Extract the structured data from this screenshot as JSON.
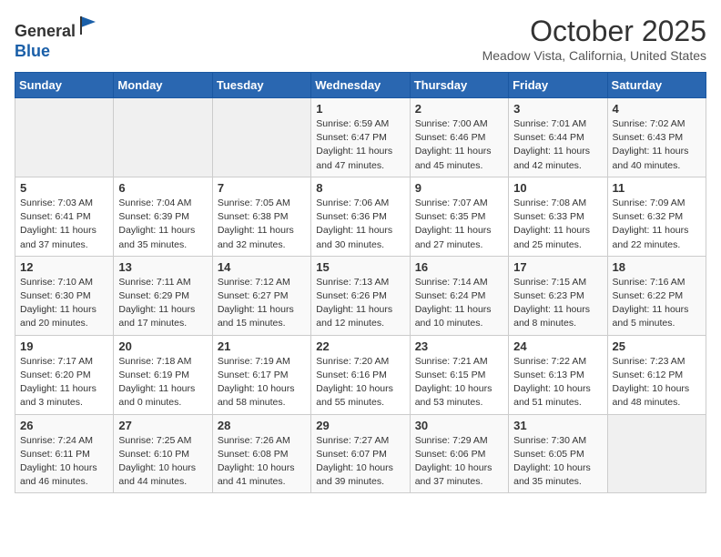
{
  "header": {
    "logo_line1": "General",
    "logo_line2": "Blue",
    "month": "October 2025",
    "location": "Meadow Vista, California, United States"
  },
  "weekdays": [
    "Sunday",
    "Monday",
    "Tuesday",
    "Wednesday",
    "Thursday",
    "Friday",
    "Saturday"
  ],
  "weeks": [
    [
      {
        "day": "",
        "info": ""
      },
      {
        "day": "",
        "info": ""
      },
      {
        "day": "",
        "info": ""
      },
      {
        "day": "1",
        "info": "Sunrise: 6:59 AM\nSunset: 6:47 PM\nDaylight: 11 hours\nand 47 minutes."
      },
      {
        "day": "2",
        "info": "Sunrise: 7:00 AM\nSunset: 6:46 PM\nDaylight: 11 hours\nand 45 minutes."
      },
      {
        "day": "3",
        "info": "Sunrise: 7:01 AM\nSunset: 6:44 PM\nDaylight: 11 hours\nand 42 minutes."
      },
      {
        "day": "4",
        "info": "Sunrise: 7:02 AM\nSunset: 6:43 PM\nDaylight: 11 hours\nand 40 minutes."
      }
    ],
    [
      {
        "day": "5",
        "info": "Sunrise: 7:03 AM\nSunset: 6:41 PM\nDaylight: 11 hours\nand 37 minutes."
      },
      {
        "day": "6",
        "info": "Sunrise: 7:04 AM\nSunset: 6:39 PM\nDaylight: 11 hours\nand 35 minutes."
      },
      {
        "day": "7",
        "info": "Sunrise: 7:05 AM\nSunset: 6:38 PM\nDaylight: 11 hours\nand 32 minutes."
      },
      {
        "day": "8",
        "info": "Sunrise: 7:06 AM\nSunset: 6:36 PM\nDaylight: 11 hours\nand 30 minutes."
      },
      {
        "day": "9",
        "info": "Sunrise: 7:07 AM\nSunset: 6:35 PM\nDaylight: 11 hours\nand 27 minutes."
      },
      {
        "day": "10",
        "info": "Sunrise: 7:08 AM\nSunset: 6:33 PM\nDaylight: 11 hours\nand 25 minutes."
      },
      {
        "day": "11",
        "info": "Sunrise: 7:09 AM\nSunset: 6:32 PM\nDaylight: 11 hours\nand 22 minutes."
      }
    ],
    [
      {
        "day": "12",
        "info": "Sunrise: 7:10 AM\nSunset: 6:30 PM\nDaylight: 11 hours\nand 20 minutes."
      },
      {
        "day": "13",
        "info": "Sunrise: 7:11 AM\nSunset: 6:29 PM\nDaylight: 11 hours\nand 17 minutes."
      },
      {
        "day": "14",
        "info": "Sunrise: 7:12 AM\nSunset: 6:27 PM\nDaylight: 11 hours\nand 15 minutes."
      },
      {
        "day": "15",
        "info": "Sunrise: 7:13 AM\nSunset: 6:26 PM\nDaylight: 11 hours\nand 12 minutes."
      },
      {
        "day": "16",
        "info": "Sunrise: 7:14 AM\nSunset: 6:24 PM\nDaylight: 11 hours\nand 10 minutes."
      },
      {
        "day": "17",
        "info": "Sunrise: 7:15 AM\nSunset: 6:23 PM\nDaylight: 11 hours\nand 8 minutes."
      },
      {
        "day": "18",
        "info": "Sunrise: 7:16 AM\nSunset: 6:22 PM\nDaylight: 11 hours\nand 5 minutes."
      }
    ],
    [
      {
        "day": "19",
        "info": "Sunrise: 7:17 AM\nSunset: 6:20 PM\nDaylight: 11 hours\nand 3 minutes."
      },
      {
        "day": "20",
        "info": "Sunrise: 7:18 AM\nSunset: 6:19 PM\nDaylight: 11 hours\nand 0 minutes."
      },
      {
        "day": "21",
        "info": "Sunrise: 7:19 AM\nSunset: 6:17 PM\nDaylight: 10 hours\nand 58 minutes."
      },
      {
        "day": "22",
        "info": "Sunrise: 7:20 AM\nSunset: 6:16 PM\nDaylight: 10 hours\nand 55 minutes."
      },
      {
        "day": "23",
        "info": "Sunrise: 7:21 AM\nSunset: 6:15 PM\nDaylight: 10 hours\nand 53 minutes."
      },
      {
        "day": "24",
        "info": "Sunrise: 7:22 AM\nSunset: 6:13 PM\nDaylight: 10 hours\nand 51 minutes."
      },
      {
        "day": "25",
        "info": "Sunrise: 7:23 AM\nSunset: 6:12 PM\nDaylight: 10 hours\nand 48 minutes."
      }
    ],
    [
      {
        "day": "26",
        "info": "Sunrise: 7:24 AM\nSunset: 6:11 PM\nDaylight: 10 hours\nand 46 minutes."
      },
      {
        "day": "27",
        "info": "Sunrise: 7:25 AM\nSunset: 6:10 PM\nDaylight: 10 hours\nand 44 minutes."
      },
      {
        "day": "28",
        "info": "Sunrise: 7:26 AM\nSunset: 6:08 PM\nDaylight: 10 hours\nand 41 minutes."
      },
      {
        "day": "29",
        "info": "Sunrise: 7:27 AM\nSunset: 6:07 PM\nDaylight: 10 hours\nand 39 minutes."
      },
      {
        "day": "30",
        "info": "Sunrise: 7:29 AM\nSunset: 6:06 PM\nDaylight: 10 hours\nand 37 minutes."
      },
      {
        "day": "31",
        "info": "Sunrise: 7:30 AM\nSunset: 6:05 PM\nDaylight: 10 hours\nand 35 minutes."
      },
      {
        "day": "",
        "info": ""
      }
    ]
  ]
}
